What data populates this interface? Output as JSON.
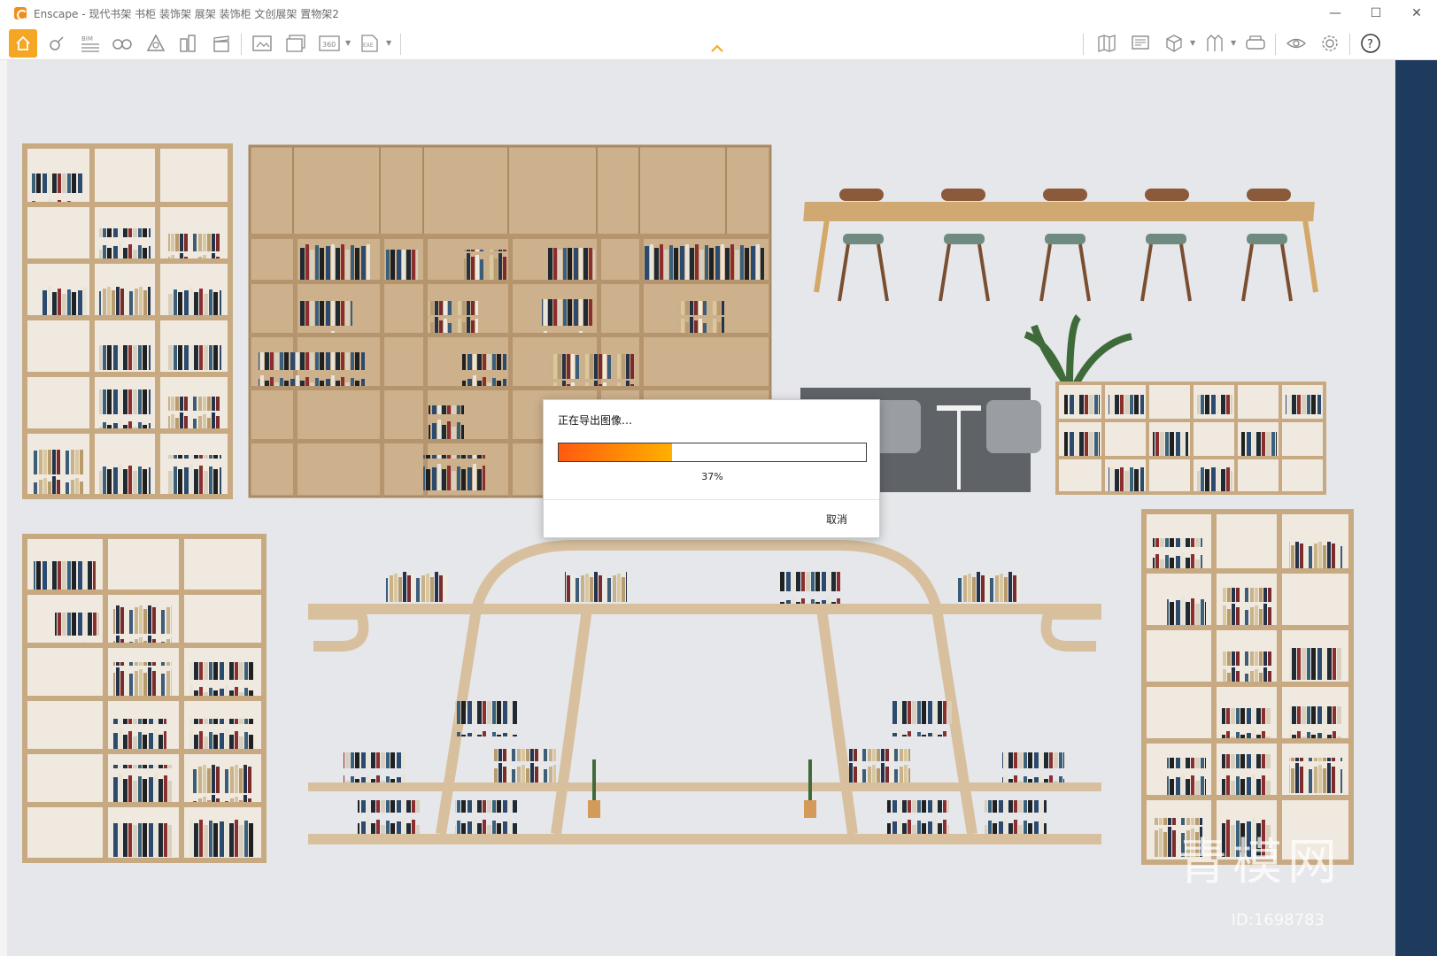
{
  "window": {
    "title": "Enscape - 现代书架 书柜 装饰架 展架 装饰柜 文创展架 置物架2",
    "minimize": "—",
    "maximize": "☐",
    "close": "✕"
  },
  "toolbar": {
    "left_buttons": [
      {
        "name": "home-icon",
        "glyph": "⌂"
      },
      {
        "name": "asset-library-icon",
        "glyph": "⚲"
      },
      {
        "name": "bim-icon",
        "glyph": "BIM"
      },
      {
        "name": "binoculars-icon",
        "glyph": "∞"
      },
      {
        "name": "materials-icon",
        "glyph": "◬"
      },
      {
        "name": "buildings-icon",
        "glyph": "▥"
      },
      {
        "name": "clapperboard-icon",
        "glyph": "▤"
      },
      {
        "name": "screenshot-icon",
        "glyph": "⎙"
      },
      {
        "name": "batch-render-icon",
        "glyph": "⧉"
      },
      {
        "name": "panorama-360-icon",
        "glyph": "360"
      },
      {
        "name": "export-exe-icon",
        "glyph": "EXE"
      }
    ],
    "right_buttons": [
      {
        "name": "map-icon",
        "glyph": "▦"
      },
      {
        "name": "monitor-icon",
        "glyph": "▣"
      },
      {
        "name": "cube-icon",
        "glyph": "⬡"
      },
      {
        "name": "path-icon",
        "glyph": "⋀"
      },
      {
        "name": "vr-headset-icon",
        "glyph": "◘"
      },
      {
        "name": "eye-icon",
        "glyph": "◉"
      },
      {
        "name": "gear-icon",
        "glyph": "⚙"
      },
      {
        "name": "help-icon",
        "glyph": "?"
      }
    ]
  },
  "dialog": {
    "title": "正在导出图像…",
    "progress": 0.37,
    "progress_label": "37%",
    "cancel_label": "取消"
  },
  "watermark": {
    "brand": "青模网",
    "id_label": "ID:1698783"
  },
  "colors": {
    "accent": "#f5a623",
    "progress_start": "#ff5a10",
    "progress_end": "#ffb000"
  }
}
